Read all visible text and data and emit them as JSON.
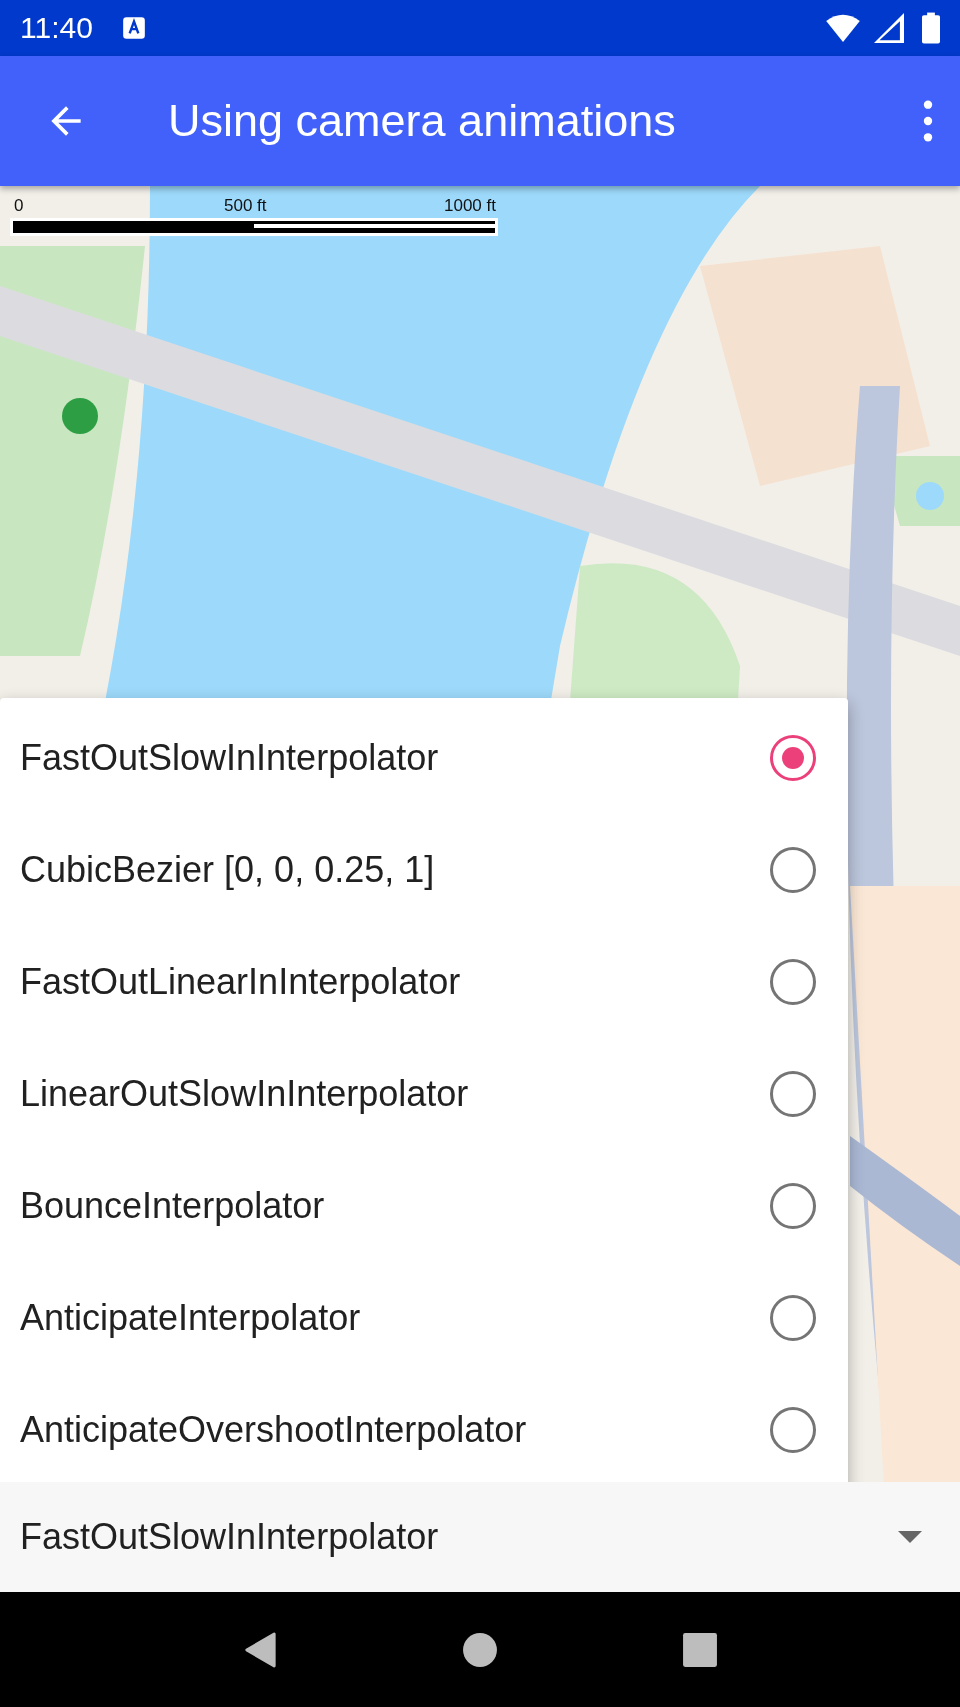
{
  "status_bar": {
    "time": "11:40"
  },
  "app_bar": {
    "title": "Using camera animations"
  },
  "map": {
    "scale_bar": {
      "labels": [
        "0",
        "500 ft",
        "1000 ft"
      ]
    }
  },
  "menu": {
    "items": [
      {
        "label": "FastOutSlowInInterpolator",
        "selected": true
      },
      {
        "label": "CubicBezier [0, 0, 0.25, 1]",
        "selected": false
      },
      {
        "label": "FastOutLinearInInterpolator",
        "selected": false
      },
      {
        "label": "LinearOutSlowInInterpolator",
        "selected": false
      },
      {
        "label": "BounceInterpolator",
        "selected": false
      },
      {
        "label": "AnticipateInterpolator",
        "selected": false
      },
      {
        "label": "AnticipateOvershootInterpolator",
        "selected": false
      }
    ]
  },
  "spinner": {
    "value": "FastOutSlowInInterpolator"
  }
}
